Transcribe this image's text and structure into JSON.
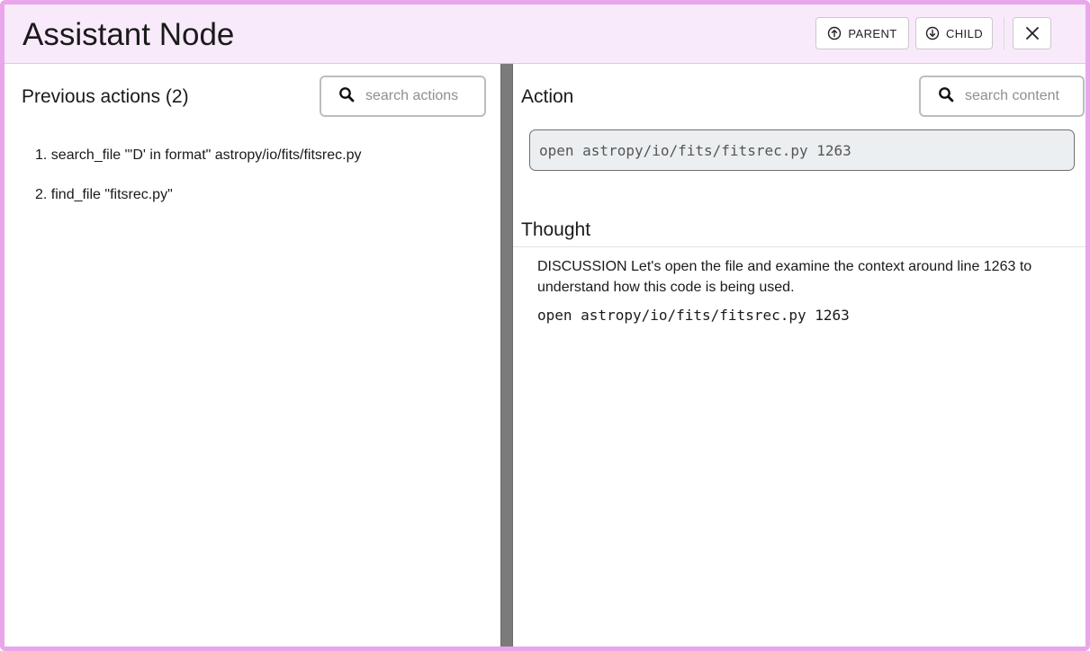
{
  "header": {
    "title": "Assistant Node",
    "parent_label": "PARENT",
    "child_label": "CHILD",
    "close_label": "✕"
  },
  "left": {
    "title": "Previous actions (2)",
    "search_placeholder": "search actions",
    "actions": [
      "1. search_file \"'D' in format\" astropy/io/fits/fitsrec.py",
      "2. find_file \"fitsrec.py\""
    ]
  },
  "right": {
    "action_title": "Action",
    "search_placeholder": "search content",
    "action_code": "open astropy/io/fits/fitsrec.py 1263",
    "thought_title": "Thought",
    "thought_lines": [
      "DISCUSSION Let's open the file and examine the context around line 1263 to",
      "understand how this code is being used."
    ],
    "thought_code": "open astropy/io/fits/fitsrec.py 1263"
  },
  "colors": {
    "frame_border": "#e9a6ea",
    "header_bg": "#f8eafb",
    "divider": "#7b7b7b",
    "code_bg": "#eceff1"
  },
  "icons": {
    "parent": "arrow-up-circle-icon",
    "child": "arrow-down-circle-icon",
    "close": "close-icon",
    "search": "search-icon"
  }
}
